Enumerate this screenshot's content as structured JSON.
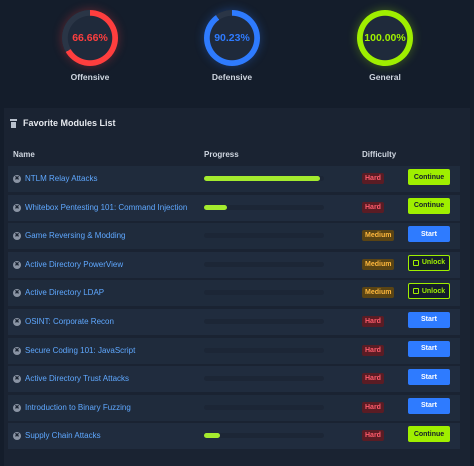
{
  "stats": [
    {
      "value": "66.66%",
      "label": "Offensive",
      "color": "#ff3e3e",
      "progress": 0.6666
    },
    {
      "value": "90.23%",
      "label": "Defensive",
      "color": "#2e7bff",
      "progress": 0.9023
    },
    {
      "value": "100.00%",
      "label": "General",
      "color": "#9fef00",
      "progress": 1.0
    }
  ],
  "panel": {
    "title": "Favorite Modules List",
    "headers": {
      "name": "Name",
      "progress": "Progress",
      "difficulty": "Difficulty"
    }
  },
  "modules": [
    {
      "name": "NTLM Relay Attacks",
      "progress": 0.97,
      "difficulty": "Hard",
      "action": "Continue"
    },
    {
      "name": "Whitebox Pentesting 101: Command Injection",
      "progress": 0.19,
      "difficulty": "Hard",
      "action": "Continue"
    },
    {
      "name": "Game Reversing & Modding",
      "progress": 0,
      "difficulty": "Medium",
      "action": "Start"
    },
    {
      "name": "Active Directory PowerView",
      "progress": 0,
      "difficulty": "Medium",
      "action": "Unlock"
    },
    {
      "name": "Active Directory LDAP",
      "progress": 0,
      "difficulty": "Medium",
      "action": "Unlock"
    },
    {
      "name": "OSINT: Corporate Recon",
      "progress": 0,
      "difficulty": "Hard",
      "action": "Start"
    },
    {
      "name": "Secure Coding 101: JavaScript",
      "progress": 0,
      "difficulty": "Hard",
      "action": "Start"
    },
    {
      "name": "Active Directory Trust Attacks",
      "progress": 0,
      "difficulty": "Hard",
      "action": "Start"
    },
    {
      "name": "Introduction to Binary Fuzzing",
      "progress": 0,
      "difficulty": "Hard",
      "action": "Start"
    },
    {
      "name": "Supply Chain Attacks",
      "progress": 0.13,
      "difficulty": "Hard",
      "action": "Continue"
    }
  ]
}
